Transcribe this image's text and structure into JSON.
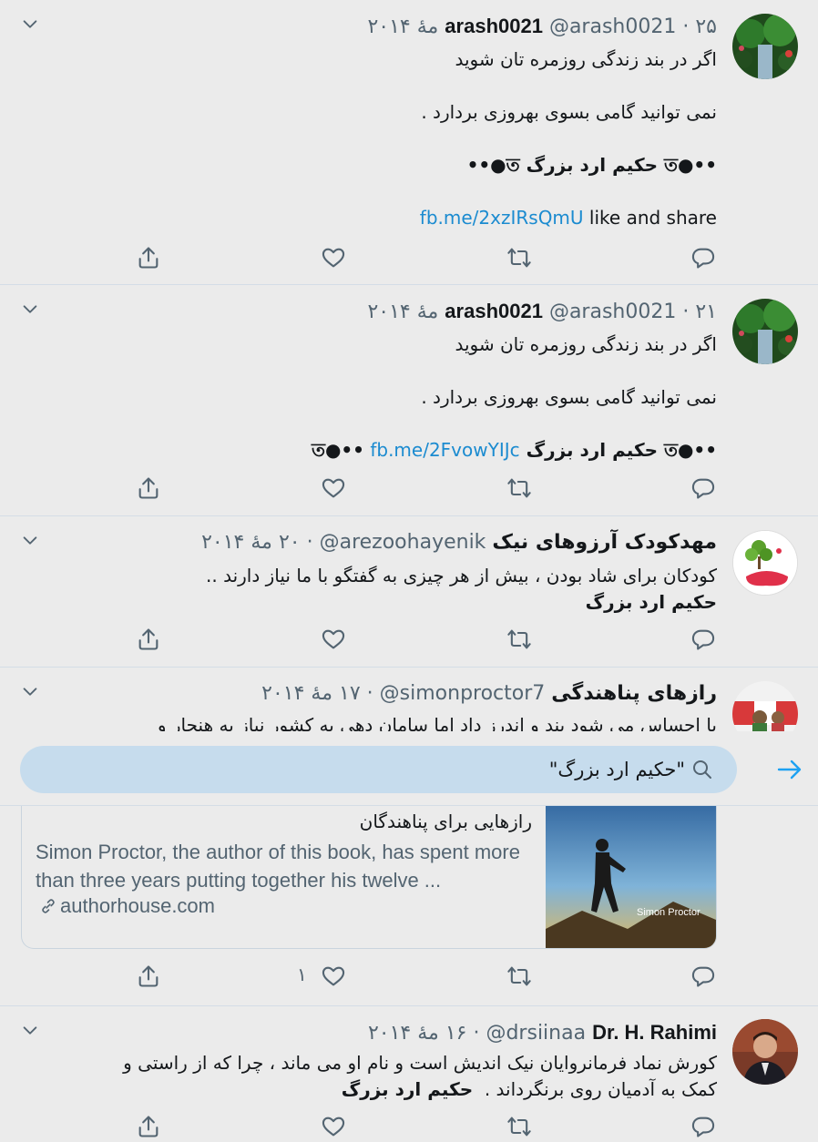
{
  "tweets": [
    {
      "name": "arash0021",
      "handle": "@arash0021",
      "date": "۲۵ مهٔ ۲۰۱۴",
      "lines": [
        "اگر در بند زندگی روزمره تان شوید",
        "",
        "نمی توانید گامی بسوی بهروزی بردارد .",
        "",
        "••●ত حکیم ارد بزرگ ত●••"
      ],
      "link_line_text": " like and share",
      "link": "fb.me/2xzIRsQmU"
    },
    {
      "name": "arash0021",
      "handle": "@arash0021",
      "date": "۲۱ مهٔ ۲۰۱۴",
      "lines": [
        "اگر در بند زندگی روزمره تان شوید",
        "",
        "نمی توانید گامی بسوی بهروزی بردارد ."
      ],
      "bold_line": "••●ত حکیم ارد بزرگ ত●••",
      "link": "fb.me/2FvowYIJc"
    },
    {
      "name": "مهدکودک آرزوهای نیک",
      "handle": "@arezoohayenik",
      "date": "۲۰ مهٔ ۲۰۱۴",
      "line1": "کودکان برای شاد بودن ، بیش از هر چیزی به گفتگو با ما نیاز دارند  ..",
      "line2": "حکیم ارد بزرگ"
    },
    {
      "name": "رازهای پناهندگی",
      "handle": "@simonproctor7",
      "date": "۱۷ مهٔ ۲۰۱۴",
      "line1": "با احساس می شود بند و اندرز داد اما سامان دهی به کشور نیاز به هنجار و",
      "like_count": "۱"
    },
    {
      "name": "Dr. H. Rahimi",
      "handle": "@drsiinaa",
      "date": "۱۶ مهٔ ۲۰۱۴",
      "line1": "کورش نماد فرمانروایان نیک اندیش است و نام او می ماند ، چرا که از راستی و",
      "line2": "کمک به آدمیان روی برنگرداند .",
      "line2_bold": "حکیم ارد بزرگ"
    }
  ],
  "search": {
    "value": "\"حکیم ارد بزرگ\""
  },
  "card": {
    "title": "رازهایی برای پناهندگان",
    "description": "Simon Proctor, the author of this book, has spent more than three years putting together his twelve ...",
    "domain": "authorhouse.com",
    "image_caption": "Simon Proctor"
  },
  "separator": "·",
  "colors": {
    "background": "#ebebeb",
    "search_field": "#c6dced",
    "link": "#1b8bd0",
    "accent": "#1da1f2"
  }
}
